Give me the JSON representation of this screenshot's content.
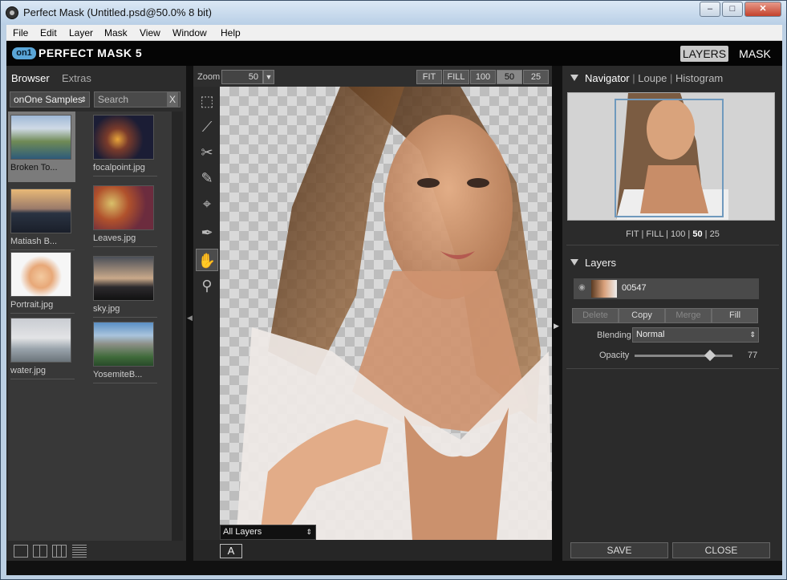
{
  "window": {
    "title": "Perfect Mask (Untitled.psd@50.0% 8 bit)",
    "controls": [
      "–",
      "□",
      "✕"
    ]
  },
  "menu": [
    "File",
    "Edit",
    "Layer",
    "Mask",
    "View",
    "Window",
    "Help"
  ],
  "brand": {
    "logo": "on1",
    "name": "PERFECT MASK 5",
    "modes": [
      "LAYERS",
      "MASK"
    ],
    "active_mode": "LAYERS"
  },
  "browser": {
    "tabs": [
      "Browser",
      "Extras"
    ],
    "source": "onOne Samples",
    "search_placeholder": "Search",
    "clear": "X",
    "thumbnails": [
      {
        "name": "Broken To...",
        "selected": true
      },
      {
        "name": "focalpoint.jpg",
        "selected": false
      },
      {
        "name": "Matiash B...",
        "selected": false
      },
      {
        "name": "Leaves.jpg",
        "selected": false
      },
      {
        "name": "Portrait.jpg",
        "selected": false
      },
      {
        "name": "sky.jpg",
        "selected": false
      },
      {
        "name": "water.jpg",
        "selected": false
      },
      {
        "name": "YosemiteB...",
        "selected": false
      }
    ]
  },
  "zoom": {
    "label": "Zoom",
    "value": "50",
    "presets": [
      "FIT",
      "FILL",
      "100",
      "50",
      "25"
    ],
    "active": "50"
  },
  "canvas": {
    "layer_select": "All Layers",
    "a_button": "A"
  },
  "navigator": {
    "tabs": [
      "Navigator",
      "Loupe",
      "Histogram"
    ],
    "zoom_links": [
      "FIT",
      "FILL",
      "100",
      "50",
      "25"
    ],
    "active_zoom": "50"
  },
  "layers": {
    "title": "Layers",
    "layer_name": "00547",
    "buttons": [
      "Delete",
      "Copy",
      "Merge",
      "Fill"
    ],
    "blending_label": "Blending",
    "blending_value": "Normal",
    "opacity_label": "Opacity",
    "opacity_value": "77",
    "opacity": 77
  },
  "footer": {
    "save": "SAVE",
    "close": "CLOSE"
  }
}
